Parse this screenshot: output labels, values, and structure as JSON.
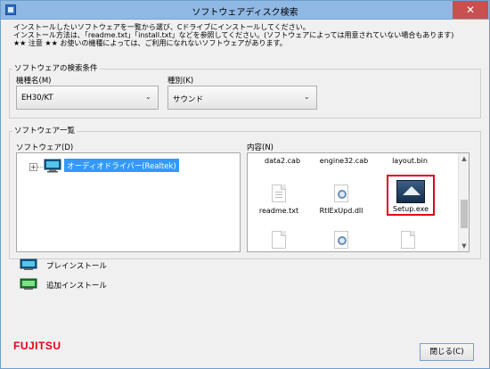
{
  "window": {
    "title": "ソフトウェアディスク検索",
    "close_glyph": "✕"
  },
  "intro": {
    "line1": "インストールしたいソフトウェアを一覧から選び、Cドライブにインストールしてください。",
    "line2": "インストール方法は、「readme.txt」「install.txt」などを参照してください。(ソフトウェアによっては用意されていない場合もあります)",
    "line3": "★★ 注意 ★★ お使いの機種によっては、ご利用になれないソフトウェアがあります。"
  },
  "search_conditions": {
    "title": "ソフトウェアの検索条件",
    "model_label": "機種名(M)",
    "model_value": "EH30/KT",
    "type_label": "種別(K)",
    "type_value": "サウンド"
  },
  "software_list": {
    "title": "ソフトウェア一覧",
    "software_label": "ソフトウェア(D)",
    "contents_label": "内容(N)",
    "tree": [
      {
        "label": "オーディオドライバー(Realtek)",
        "selected": true,
        "expander": "+"
      }
    ],
    "files": [
      {
        "name": "data2.cab"
      },
      {
        "name": "engine32.cab"
      },
      {
        "name": "layout.bin"
      },
      {
        "name": "readme.txt"
      },
      {
        "name": "RtlExUpd.dll"
      },
      {
        "name": "Setup.exe",
        "highlighted": true
      }
    ],
    "scroll_up": "▲",
    "scroll_down": "▼"
  },
  "legend": {
    "preinstall": "プレインストール",
    "additional": "追加インストール"
  },
  "footer": {
    "logo": "FUJITSU",
    "close_button": "閉じる(C)"
  },
  "colors": {
    "selection": "#3399ff",
    "highlight_border": "#e0001a",
    "logo_red": "#e60012"
  }
}
